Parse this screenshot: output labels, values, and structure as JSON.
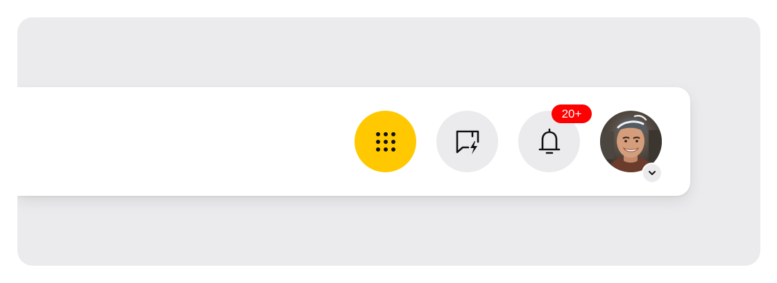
{
  "header": {
    "apps_button": {
      "icon": "grid-dots-icon",
      "color": "#ffc800"
    },
    "quick_message_button": {
      "icon": "message-lightning-icon",
      "color": "#ebebed"
    },
    "notifications_button": {
      "icon": "bell-icon",
      "color": "#ebebed",
      "badge": "20+",
      "badge_color": "#ff0000"
    },
    "profile": {
      "avatar": "user-avatar-photo",
      "dropdown_icon": "chevron-down-icon"
    }
  }
}
